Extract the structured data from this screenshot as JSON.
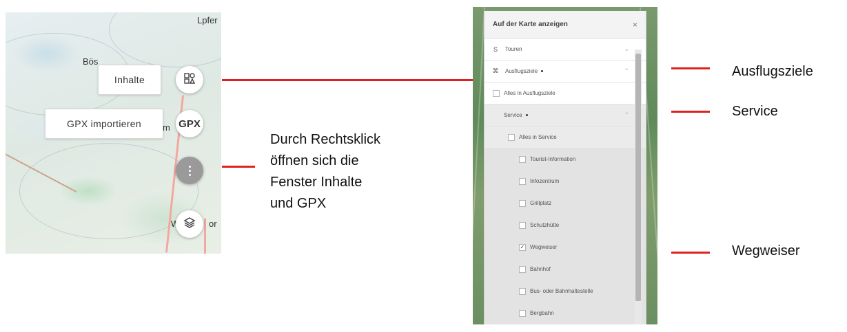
{
  "left_map": {
    "place_labels": [
      "Lpfer",
      "Bös",
      "m",
      "W",
      "or"
    ],
    "tooltip_inhalte": "Inhalte",
    "tooltip_gpx": "GPX importieren",
    "buttons": [
      {
        "icon": "content-icon"
      },
      {
        "label": "GPX"
      },
      {
        "icon": "more-vertical-icon"
      },
      {
        "icon": "layers-icon"
      }
    ]
  },
  "caption": {
    "lines": [
      "Durch Rechtsklick",
      "öffnen sich die",
      "Fenster Inhalte",
      "und GPX"
    ]
  },
  "panel": {
    "title": "Auf der Karte anzeigen",
    "close": "×",
    "rows": [
      {
        "lead": "S",
        "label": "Touren",
        "chevron": "⌄"
      },
      {
        "lead": "⌘",
        "label": "Ausflugsziele",
        "dot": true,
        "chevron": "⌃"
      },
      {
        "checkbox": false,
        "label": "Alles in Ausflugsziele"
      },
      {
        "label": "Service",
        "dot": true,
        "chevron": "⌃"
      },
      {
        "checkbox": false,
        "label": "Alles in Service"
      },
      {
        "checkbox": false,
        "label": "Tourist-Information"
      },
      {
        "checkbox": false,
        "label": "Infozentrum"
      },
      {
        "checkbox": false,
        "label": "Grillplatz"
      },
      {
        "checkbox": false,
        "label": "Schutzhütte"
      },
      {
        "checkbox": true,
        "label": "Wegweiser"
      },
      {
        "checkbox": false,
        "label": "Bahnhof"
      },
      {
        "checkbox": false,
        "label": "Bus- oder Bahnhaltestelle"
      },
      {
        "checkbox": false,
        "label": "Bergbahn"
      }
    ]
  },
  "annotations": {
    "ausflugsziele": "Ausflugsziele",
    "service": "Service",
    "wegweiser": "Wegweiser"
  },
  "colors": {
    "accent_red": "#e0211b"
  }
}
